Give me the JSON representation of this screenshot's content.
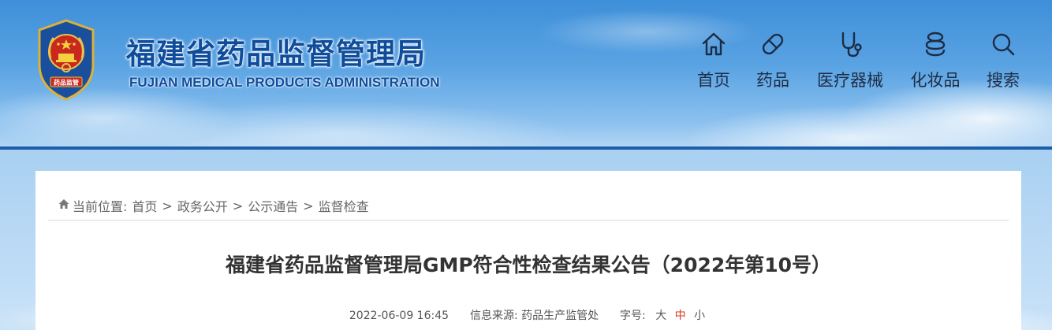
{
  "header": {
    "title_cn": "福建省药品监督管理局",
    "title_en": "FUJIAN MEDICAL PRODUCTS ADMINISTRATION",
    "emblem_text": "药品监管",
    "colors": {
      "brand_blue": "#0e4c9c",
      "header_line": "#1c5ea8"
    }
  },
  "nav": {
    "items": [
      {
        "label": "首页",
        "icon": "home-icon"
      },
      {
        "label": "药品",
        "icon": "pill-icon"
      },
      {
        "label": "医疗器械",
        "icon": "stethoscope-icon"
      },
      {
        "label": "化妆品",
        "icon": "cosmetics-icon"
      },
      {
        "label": "搜索",
        "icon": "search-icon"
      }
    ]
  },
  "breadcrumb": {
    "prefix": "当前位置:",
    "items": [
      "首页",
      "政务公开",
      "公示通告",
      "监督检查"
    ],
    "separator": ">"
  },
  "article": {
    "title": "福建省药品监督管理局GMP符合性检查结果公告（2022年第10号）",
    "date": "2022-06-09 16:45",
    "source_label": "信息来源:",
    "source": "药品生产监管处",
    "font_size_label": "字号:",
    "font_sizes": [
      {
        "label": "大",
        "active": false
      },
      {
        "label": "中",
        "active": true
      },
      {
        "label": "小",
        "active": false
      }
    ],
    "colors": {
      "active_size": "#d9381e"
    }
  }
}
